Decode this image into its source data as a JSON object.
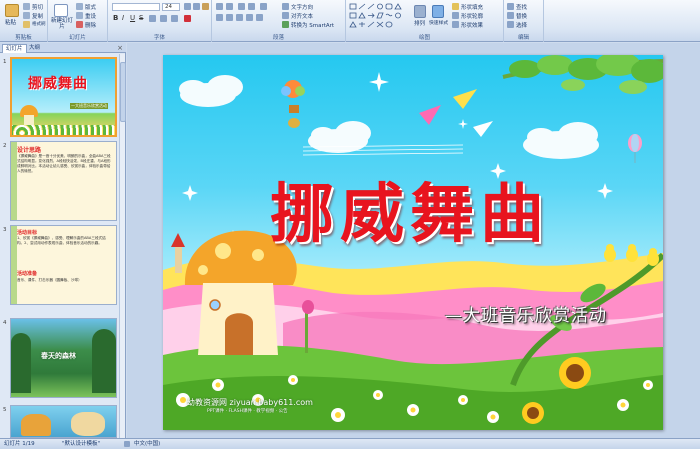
{
  "ribbon": {
    "groups": {
      "clipboard": "剪贴板",
      "slides": "幻灯片",
      "font": "字体",
      "paragraph": "段落",
      "drawing": "绘图",
      "editing": "编辑"
    },
    "buttons": {
      "paste": "粘贴",
      "cut": "剪切",
      "copy": "复制",
      "format_painter": "格式刷",
      "new_slide": "新建幻灯片",
      "layout": "版式",
      "reset": "重设",
      "delete": "删除",
      "text_direction": "文字方向",
      "align_text": "对齐文本",
      "convert_smartart": "转换为 SmartArt",
      "arrange": "排列",
      "quick_styles": "快速样式",
      "shape_fill": "形状填充",
      "shape_outline": "形状轮廓",
      "shape_effects": "形状效果",
      "find": "查找",
      "replace": "替换",
      "select": "选择"
    },
    "font_size": "24"
  },
  "left_panel": {
    "tabs": [
      "幻灯片",
      "大纲"
    ],
    "close": "×",
    "slides": [
      {
        "num": "1",
        "title": "挪威舞曲",
        "subtitle": "—大班音乐欣赏活动"
      },
      {
        "num": "2",
        "heading": "设计思路",
        "body": "《挪威舞曲》是一首十分优美、明朗的乐曲，全曲ABA三段式结构明显。变化强烈，A段轻快活泼，B段庄重，与A段形成鲜明对比。本活动让幼儿感受、欣赏乐曲，体验乐曲带给人的愉悦。"
      },
      {
        "num": "3",
        "heading": "活动目标",
        "body": "1、欣赏《挪威舞曲》，感受、理解乐曲的ABA三段式结构。2、尝试用动作表现乐曲，体验音乐活动的乐趣。",
        "heading2": "活动准备",
        "body2": "音乐、课件、打击乐器（圆舞板、沙球）"
      },
      {
        "num": "4",
        "caption": "春天的森林"
      },
      {
        "num": "5"
      }
    ]
  },
  "slide": {
    "title": "挪威舞曲",
    "subtitle": "—大班音乐欣赏活动",
    "watermark": "幼教资源网 ziyuan.baby611.com",
    "watermark_sub": "PPT课件 · FLASH课件 · 教学视频 · 公告"
  },
  "statusbar": {
    "slide_pos": "幻灯片 1/19",
    "theme": "\"默认设计模板\"",
    "language": "中文(中国)"
  },
  "colors": {
    "title_red": "#e8141e",
    "ribbon_bg": "#dbe6f4",
    "selected_border": "#f0a030"
  }
}
